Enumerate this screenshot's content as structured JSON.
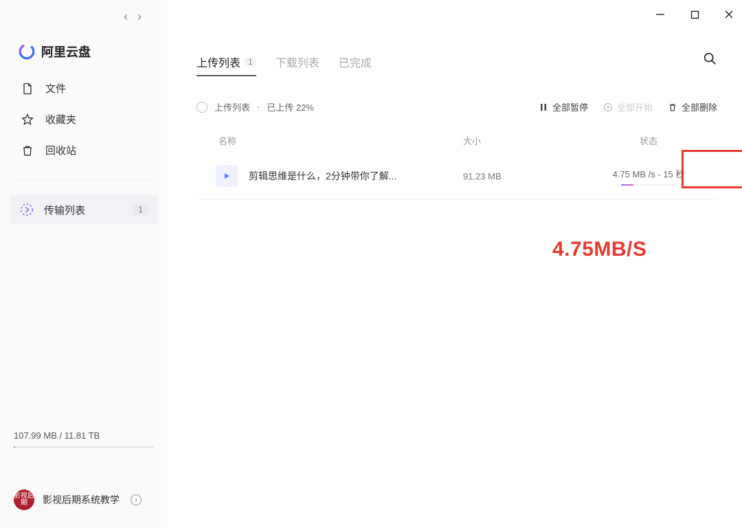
{
  "app": {
    "name": "阿里云盘"
  },
  "sidebar": {
    "items": [
      {
        "label": "文件"
      },
      {
        "label": "收藏夹"
      },
      {
        "label": "回收站"
      }
    ],
    "transfer": {
      "label": "传输列表",
      "badge": "1"
    },
    "storage": "107.99 MB / 11.81 TB",
    "user": {
      "name": "影视后期系统教学",
      "avatar_text": "影视后期"
    }
  },
  "tabs": {
    "upload": "上传列表",
    "upload_badge": "1",
    "download": "下载列表",
    "done": "已完成"
  },
  "list_header": {
    "title": "上传列表",
    "separator": "·",
    "progress": "已上传 22%",
    "pause_all": "全部暂停",
    "start_all": "全部开始",
    "delete_all": "全部删除"
  },
  "columns": {
    "name": "名称",
    "size": "大小",
    "status": "状态"
  },
  "rows": [
    {
      "name": "剪辑思维是什么，2分钟带你了解...",
      "size": "91.23 MB",
      "status": "4.75 MB /s - 15 秒"
    }
  ],
  "annotation": "4.75MB/S"
}
